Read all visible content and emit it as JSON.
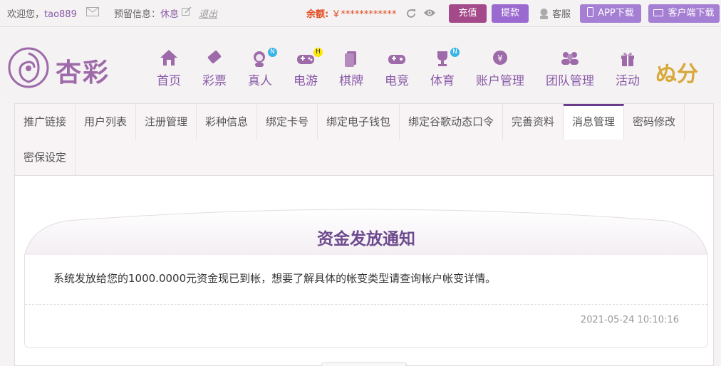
{
  "topbar": {
    "welcome": "欢迎您，",
    "username": "tao889",
    "reserved_label": "预留信息：",
    "reserved_value": "休息",
    "logout": "退出",
    "balance_label": "余额:",
    "balance_value": "￥************",
    "deposit": "充值",
    "withdraw": "提款",
    "service": "客服",
    "app_download": "APP下载",
    "client_download": "客户端下载"
  },
  "logo": {
    "text": "杏彩"
  },
  "nav": {
    "items": [
      {
        "label": "首页",
        "icon": "home-icon"
      },
      {
        "label": "彩票",
        "icon": "lottery-ticket-icon"
      },
      {
        "label": "真人",
        "icon": "live-dealer-icon",
        "badge": "N"
      },
      {
        "label": "电游",
        "icon": "gamepad-icon",
        "badge": "H"
      },
      {
        "label": "棋牌",
        "icon": "cards-icon"
      },
      {
        "label": "电竞",
        "icon": "esports-gamepad-icon"
      },
      {
        "label": "体育",
        "icon": "trophy-icon",
        "badge": "N"
      },
      {
        "label": "账户管理",
        "icon": "yuan-coin-icon"
      },
      {
        "label": "团队管理",
        "icon": "team-icon"
      },
      {
        "label": "活动",
        "icon": "gift-icon"
      }
    ],
    "points_text": "ぬ分"
  },
  "tabs": [
    "推广链接",
    "用户列表",
    "注册管理",
    "彩种信息",
    "绑定卡号",
    "绑定电子钱包",
    "绑定谷歌动态口令",
    "完善资料",
    "消息管理",
    "密码修改",
    "密保设定"
  ],
  "active_tab": "消息管理",
  "notice": {
    "title": "资金发放通知",
    "message": "系统发放给您的1000.0000元资金现已到帐，想要了解具体的帐变类型请查询帐户帐变详情。",
    "date": "2021-05-24 10:10:16"
  },
  "colors": {
    "brand": "#8a5aa8",
    "deposit": "#a4498a",
    "withdraw": "#9a6ad0",
    "balance": "#e14a1f"
  }
}
